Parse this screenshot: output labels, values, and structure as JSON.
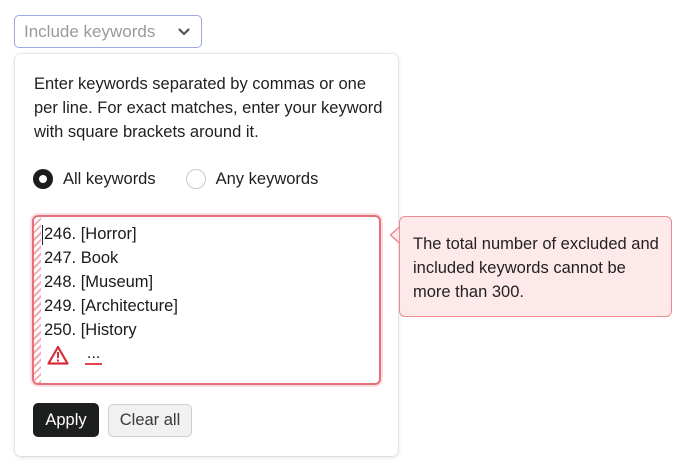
{
  "dropdown": {
    "label": "Include keywords",
    "icon": "chevron-down-icon"
  },
  "panel": {
    "instructions": "Enter keywords separated by commas or one per line. For exact matches, enter your keyword with square brackets around it.",
    "match_mode": {
      "options": [
        {
          "label": "All keywords",
          "selected": true
        },
        {
          "label": "Any keywords",
          "selected": false
        }
      ]
    },
    "keywords": {
      "lines": [
        "246. [Horror]",
        "247. Book",
        "248. [Museum]",
        "249. [Architecture]",
        "250. [History"
      ],
      "overflow": "...",
      "warning_icon": "warning-triangle-icon"
    },
    "buttons": {
      "apply": "Apply",
      "clear_all": "Clear all"
    }
  },
  "tooltip": {
    "message": "The total number of excluded and included keywords cannot be more than 300."
  },
  "colors": {
    "error_border": "#e6707a",
    "error_bg": "#fde8ea",
    "focus_border": "#9fa8e6",
    "primary_button": "#1c1f1e"
  }
}
